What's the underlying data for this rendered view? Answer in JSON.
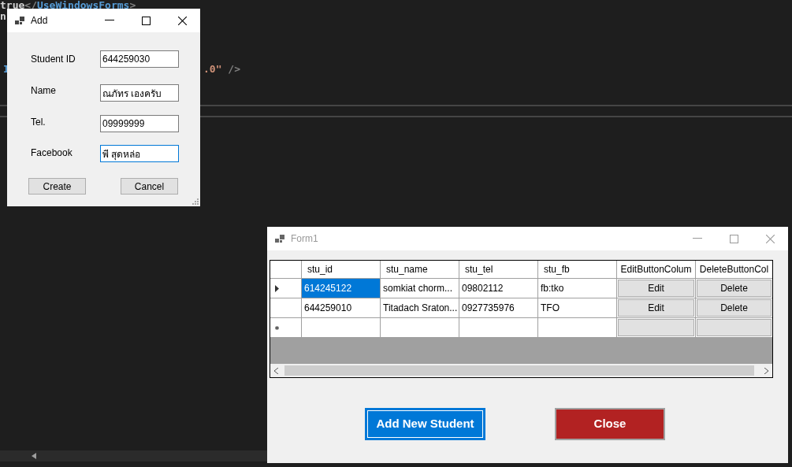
{
  "editor": {
    "lines": [
      {
        "segments": [
          {
            "text": "true",
            "kind": "text"
          },
          {
            "text": "</",
            "kind": "punct"
          },
          {
            "text": "UseWindowsForms",
            "kind": "tag"
          },
          {
            "text": ">",
            "kind": "punct"
          }
        ]
      },
      {
        "segments": [
          {
            "text": "n",
            "kind": "text"
          }
        ]
      },
      {
        "segments": [
          {
            "text": "I",
            "kind": "tag"
          }
        ]
      },
      {
        "segments": [
          {
            "text": ".0\"",
            "kind": "string"
          },
          {
            "text": " />",
            "kind": "punct"
          }
        ]
      }
    ]
  },
  "add_window": {
    "title": "Add",
    "active": true,
    "fields": [
      {
        "label": "Student ID",
        "value": "644259030",
        "focused": false
      },
      {
        "label": "Name",
        "value": "ณภัทร เองครับ",
        "focused": false
      },
      {
        "label": "Tel.",
        "value": "09999999",
        "focused": false
      },
      {
        "label": "Facebook",
        "value": "พี สุดหล่อ",
        "focused": true
      }
    ],
    "buttons": [
      "Create",
      "Cancel"
    ]
  },
  "form1": {
    "title": "Form1",
    "active": false,
    "grid": {
      "columns": [
        "stu_id",
        "stu_name",
        "stu_tel",
        "stu_fb",
        "EditButtonColum",
        "DeleteButtonCol"
      ],
      "rows": [
        {
          "kind": "data",
          "current": true,
          "cells": [
            {
              "kind": "text",
              "text": "614245122",
              "selected": true
            },
            {
              "kind": "text",
              "text": "somkiat chorm...",
              "selected": false
            },
            {
              "kind": "text",
              "text": "09802112",
              "selected": false
            },
            {
              "kind": "text",
              "text": "fb:tko",
              "selected": false
            },
            {
              "kind": "button",
              "text": "Edit"
            },
            {
              "kind": "button",
              "text": "Delete"
            }
          ]
        },
        {
          "kind": "data",
          "current": false,
          "cells": [
            {
              "kind": "text",
              "text": "644259010",
              "selected": false
            },
            {
              "kind": "text",
              "text": "Titadach Sraton...",
              "selected": false
            },
            {
              "kind": "text",
              "text": "0927735976",
              "selected": false
            },
            {
              "kind": "text",
              "text": "TFO",
              "selected": false
            },
            {
              "kind": "button",
              "text": "Edit"
            },
            {
              "kind": "button",
              "text": "Delete"
            }
          ]
        },
        {
          "kind": "new"
        }
      ]
    },
    "buttons": [
      {
        "label": "Add New Student",
        "kind": "primary"
      },
      {
        "label": "Close",
        "kind": "danger"
      }
    ]
  }
}
